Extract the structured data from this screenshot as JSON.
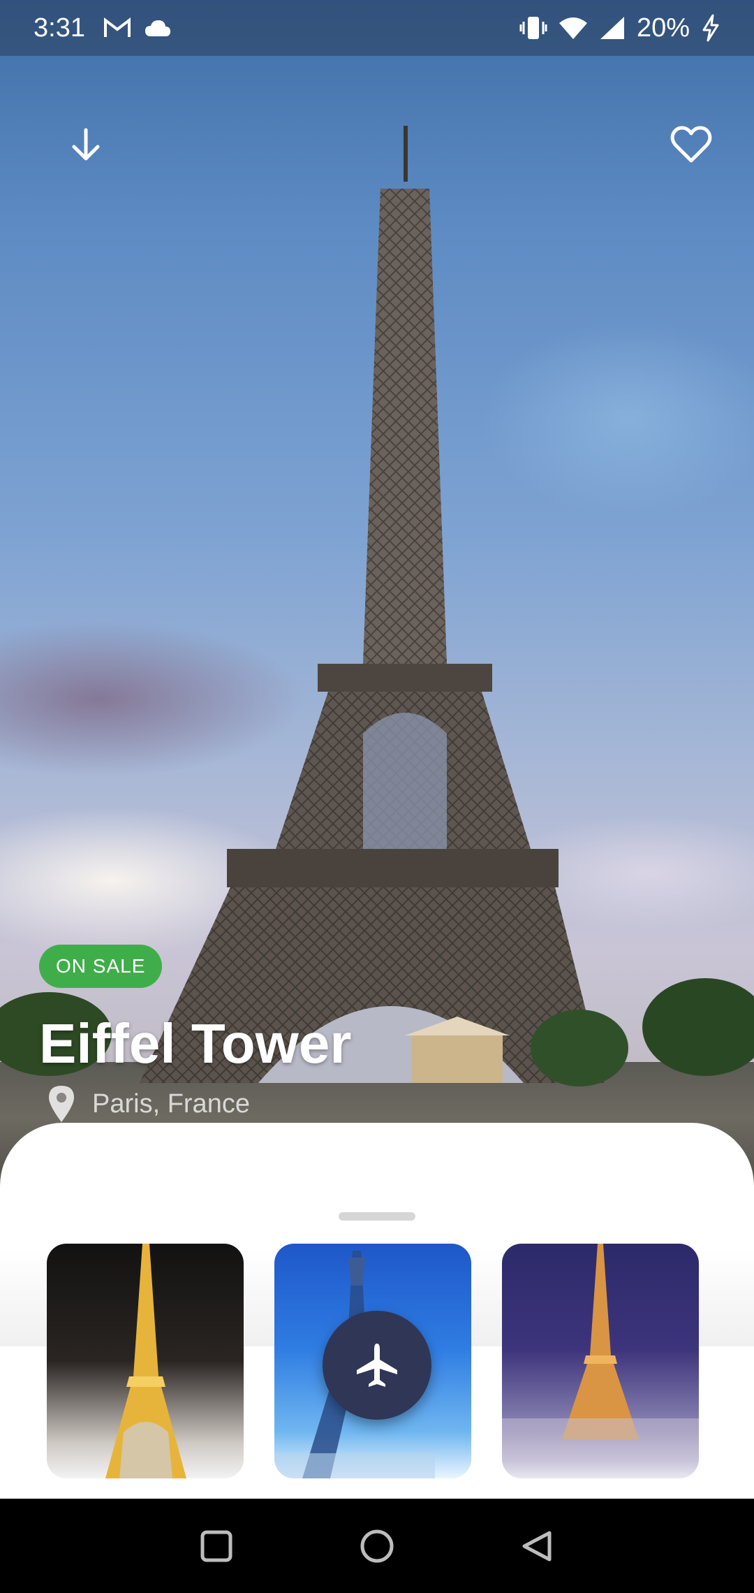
{
  "status_bar": {
    "time": "3:31",
    "battery": "20%",
    "icons": [
      "gmail-icon",
      "cloud-icon",
      "vibrate-icon",
      "wifi-icon",
      "signal-icon",
      "charging-icon"
    ]
  },
  "header": {
    "back_icon": "arrow-down-icon",
    "favorite_icon": "heart-outline-icon"
  },
  "place": {
    "badge": "ON SALE",
    "title": "Eiffel Tower",
    "location": "Paris, France"
  },
  "gallery": {
    "images": [
      "eiffel-tower-night",
      "eiffel-tower-blue-sky",
      "eiffel-tower-purple-night"
    ],
    "fab_icon": "airplane-icon"
  },
  "colors": {
    "badge": "#3fae4a",
    "fab": "#2f3656"
  },
  "navigation": [
    "recents-square-icon",
    "home-circle-icon",
    "back-triangle-icon"
  ]
}
